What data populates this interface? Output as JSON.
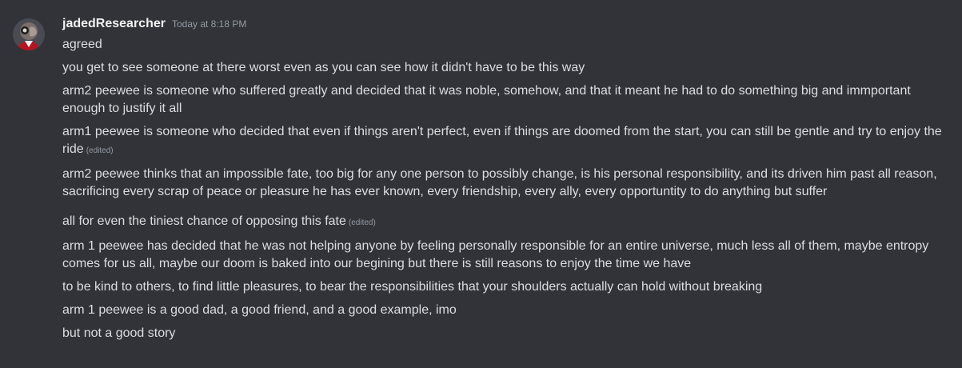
{
  "message": {
    "username": "jadedResearcher",
    "timestamp": "Today at 8:18 PM",
    "edited_label": "(edited)",
    "lines": [
      {
        "text": "agreed",
        "edited": false
      },
      {
        "text": "you get to see someone at there worst even as you can see how it didn't have to be this way",
        "edited": false
      },
      {
        "text": "arm2 peewee is someone who suffered greatly and decided that it was noble, somehow, and that it meant he had to do something big and immportant enough to justify it all",
        "edited": false
      },
      {
        "text": "arm1 peewee is someone who decided that even if things aren't perfect, even if things are doomed from the start, you can still be gentle and try to enjoy the ride",
        "edited": true
      },
      {
        "text": "arm2 peewee thinks that an impossible fate, too big for any one person to possibly change, is his personal responsibility, and its driven him past all reason, sacrificing every scrap of peace or pleasure he has ever known, every friendship, every ally, every opportuntity to do anything but suffer",
        "edited": false
      },
      {
        "text": "all for even the tiniest chance of opposing this fate",
        "edited": true
      },
      {
        "text": "arm 1 peewee has decided that he was not helping anyone by feeling personally responsible for an entire universe, much less all of them, maybe entropy comes for us all, maybe our doom is baked into our begining but there is still reasons to enjoy the time we have",
        "edited": false
      },
      {
        "text": "to be kind to others, to find little pleasures, to bear the responsibilities that your shoulders actually can hold without breaking",
        "edited": false
      },
      {
        "text": "arm 1 peewee is a good dad, a good friend, and a good example, imo",
        "edited": false
      },
      {
        "text": "but not a good story",
        "edited": false
      }
    ]
  },
  "colors": {
    "background": "#313338",
    "text": "#dbdee1",
    "username": "#f2f3f5",
    "muted": "#949ba4"
  },
  "icons": {
    "avatar": "user-avatar-icon"
  }
}
